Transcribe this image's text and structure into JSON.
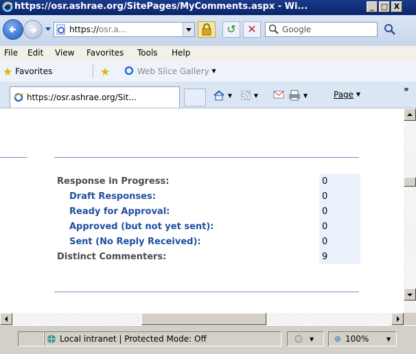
{
  "window": {
    "title": "https://osr.ashrae.org/SitePages/MyComments.aspx - Wi...",
    "minimize": "_",
    "maximize": "□",
    "close": "X"
  },
  "addressbar": {
    "url_host": "https://",
    "url_rest": "osr.a...",
    "search_placeholder": "Google"
  },
  "menubar": {
    "items": [
      "File",
      "Edit",
      "View",
      "Favorites",
      "Tools",
      "Help"
    ]
  },
  "favorites_bar": {
    "favorites_label": "Favorites",
    "web_slice_label": "Web Slice Gallery"
  },
  "tabs": {
    "active_tab_label": "https://osr.ashrae.org/Sit..."
  },
  "command_bar": {
    "page_label": "Page",
    "overflow": "»"
  },
  "stats": {
    "rows": [
      {
        "label": "Response in Progress:",
        "value": "0"
      },
      {
        "label": "Draft Responses:",
        "value": "0"
      },
      {
        "label": "Ready for Approval:",
        "value": "0"
      },
      {
        "label": "Approved (but not yet sent):",
        "value": "0"
      },
      {
        "label": "Sent (No Reply Received):",
        "value": "0"
      },
      {
        "label": "Distinct Commenters:",
        "value": "9"
      }
    ]
  },
  "statusbar": {
    "zone_text": "Local intranet | Protected Mode: Off",
    "zoom": "100%"
  },
  "colors": {
    "sub_label": "#1f4fa0",
    "main_label": "#4a4a4a",
    "value_bg": "#eaf1fb",
    "rule": "#6c8fc8"
  }
}
